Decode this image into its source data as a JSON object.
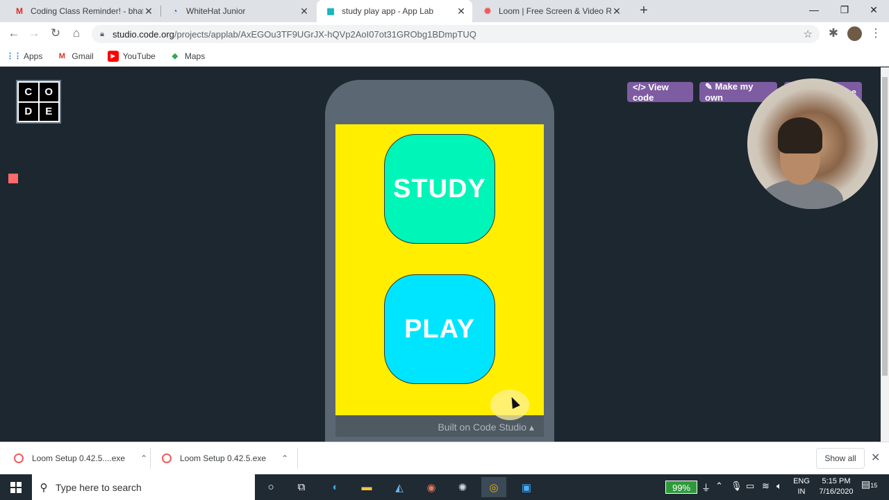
{
  "browser": {
    "tabs": [
      {
        "title": "Coding Class Reminder! - bhatias",
        "favicon": "gmail-icon",
        "favicon_text": "M",
        "favicon_color": "#d93025"
      },
      {
        "title": "WhiteHat Junior",
        "favicon": "whitehat-icon",
        "favicon_text": "◔",
        "favicon_color": "#1a73e8"
      },
      {
        "title": "study play app - App Lab",
        "favicon": "applab-icon",
        "favicon_text": "▦",
        "favicon_color": "#00adbc"
      },
      {
        "title": "Loom | Free Screen & Video Rec",
        "favicon": "loom-icon",
        "favicon_text": "✺",
        "favicon_color": "#f15a5a"
      }
    ],
    "close_glyph": "✕",
    "new_tab_glyph": "+",
    "window_controls": {
      "minimize": "—",
      "maximize": "❐",
      "close": "✕"
    },
    "address": {
      "host": "studio.code.org",
      "path": "/projects/applab/AxEGOu3TF9UGrJX-hQVp2AoI07ot31GRObg1BDmpTUQ"
    },
    "bookmarks": [
      {
        "label": "Apps",
        "icon": "apps-grid-icon",
        "glyph": "⋮⋮",
        "color": "#1a73e8"
      },
      {
        "label": "Gmail",
        "icon": "gmail-icon",
        "glyph": "M",
        "color": "#d93025"
      },
      {
        "label": "YouTube",
        "icon": "youtube-icon",
        "glyph": "▶",
        "color": "#ff0000"
      },
      {
        "label": "Maps",
        "icon": "maps-icon",
        "glyph": "◆",
        "color": "#34a853"
      }
    ]
  },
  "page": {
    "logo_letters": [
      "C",
      "O",
      "D",
      "E"
    ],
    "top_buttons": {
      "view_code": "</> View code",
      "make_my_own": "✎ Make my own",
      "remix_partial": "e"
    },
    "app": {
      "study_label": "STUDY",
      "play_label": "PLAY",
      "study_color": "#00f5b8",
      "play_color": "#00e5ff",
      "screen_color": "#ffee00"
    },
    "footer": "Built on Code Studio ▴"
  },
  "downloads": {
    "items": [
      {
        "name": "Loom Setup 0.42.5....exe"
      },
      {
        "name": "Loom Setup 0.42.5.exe"
      }
    ],
    "show_all": "Show all",
    "chevron": "⌃",
    "close": "✕"
  },
  "taskbar": {
    "search_placeholder": "Type here to search",
    "battery": "99%",
    "lang_line1": "ENG",
    "lang_line2": "IN",
    "time": "5:15 PM",
    "date": "7/16/2020",
    "notification_count": "15"
  }
}
